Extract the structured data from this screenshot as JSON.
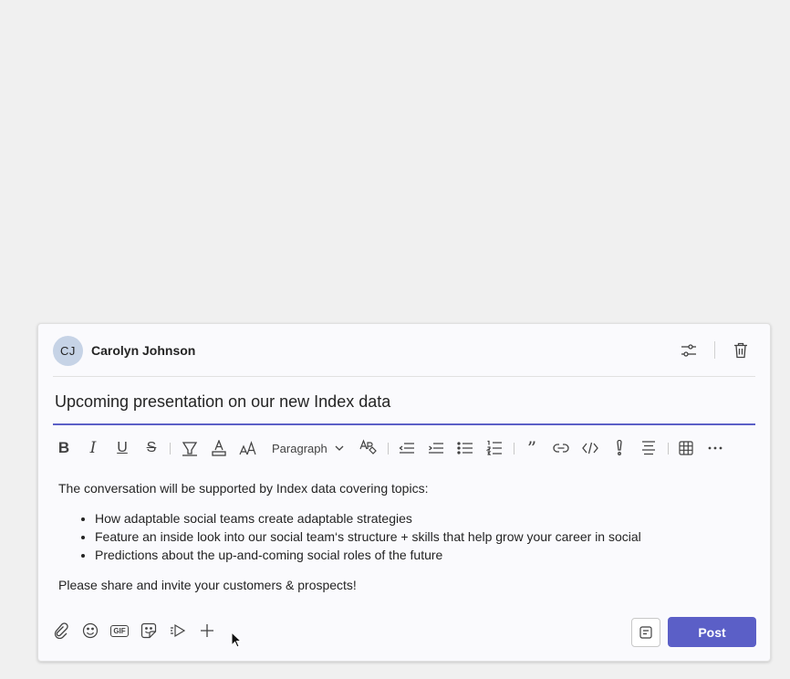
{
  "author": {
    "initials": "CJ",
    "name": "Carolyn Johnson"
  },
  "header_icons": [
    "sliders-icon",
    "trash-icon"
  ],
  "subject": "Upcoming presentation on our new Index data",
  "toolbar": {
    "paragraph_label": "Paragraph",
    "icons": [
      "bold-icon",
      "italic-icon",
      "underline-icon",
      "strikethrough-icon",
      "highlight-icon",
      "font-color-icon",
      "font-size-icon",
      "clear-format-icon",
      "decrease-indent-icon",
      "increase-indent-icon",
      "bullet-list-icon",
      "numbered-list-icon",
      "quote-icon",
      "link-icon",
      "code-icon",
      "important-icon",
      "align-icon",
      "table-icon",
      "more-icon"
    ]
  },
  "message": {
    "intro": "The conversation will be supported by Index data covering topics:",
    "bullets": [
      "How adaptable social teams create adaptable strategies",
      "Feature an inside look into our social team‘s structure + skills that help grow your career in social",
      "Predictions about the up-and-coming social roles of the future"
    ],
    "outro": "Please share and invite your customers & prospects!"
  },
  "bottom_icons": [
    "attach-icon",
    "emoji-icon",
    "gif-icon",
    "sticker-icon",
    "send-video-icon",
    "plus-icon"
  ],
  "gif_label": "GIF",
  "post_label": "Post",
  "colors": {
    "accent": "#5b5fc7",
    "avatar_bg": "#c6d3e6"
  }
}
